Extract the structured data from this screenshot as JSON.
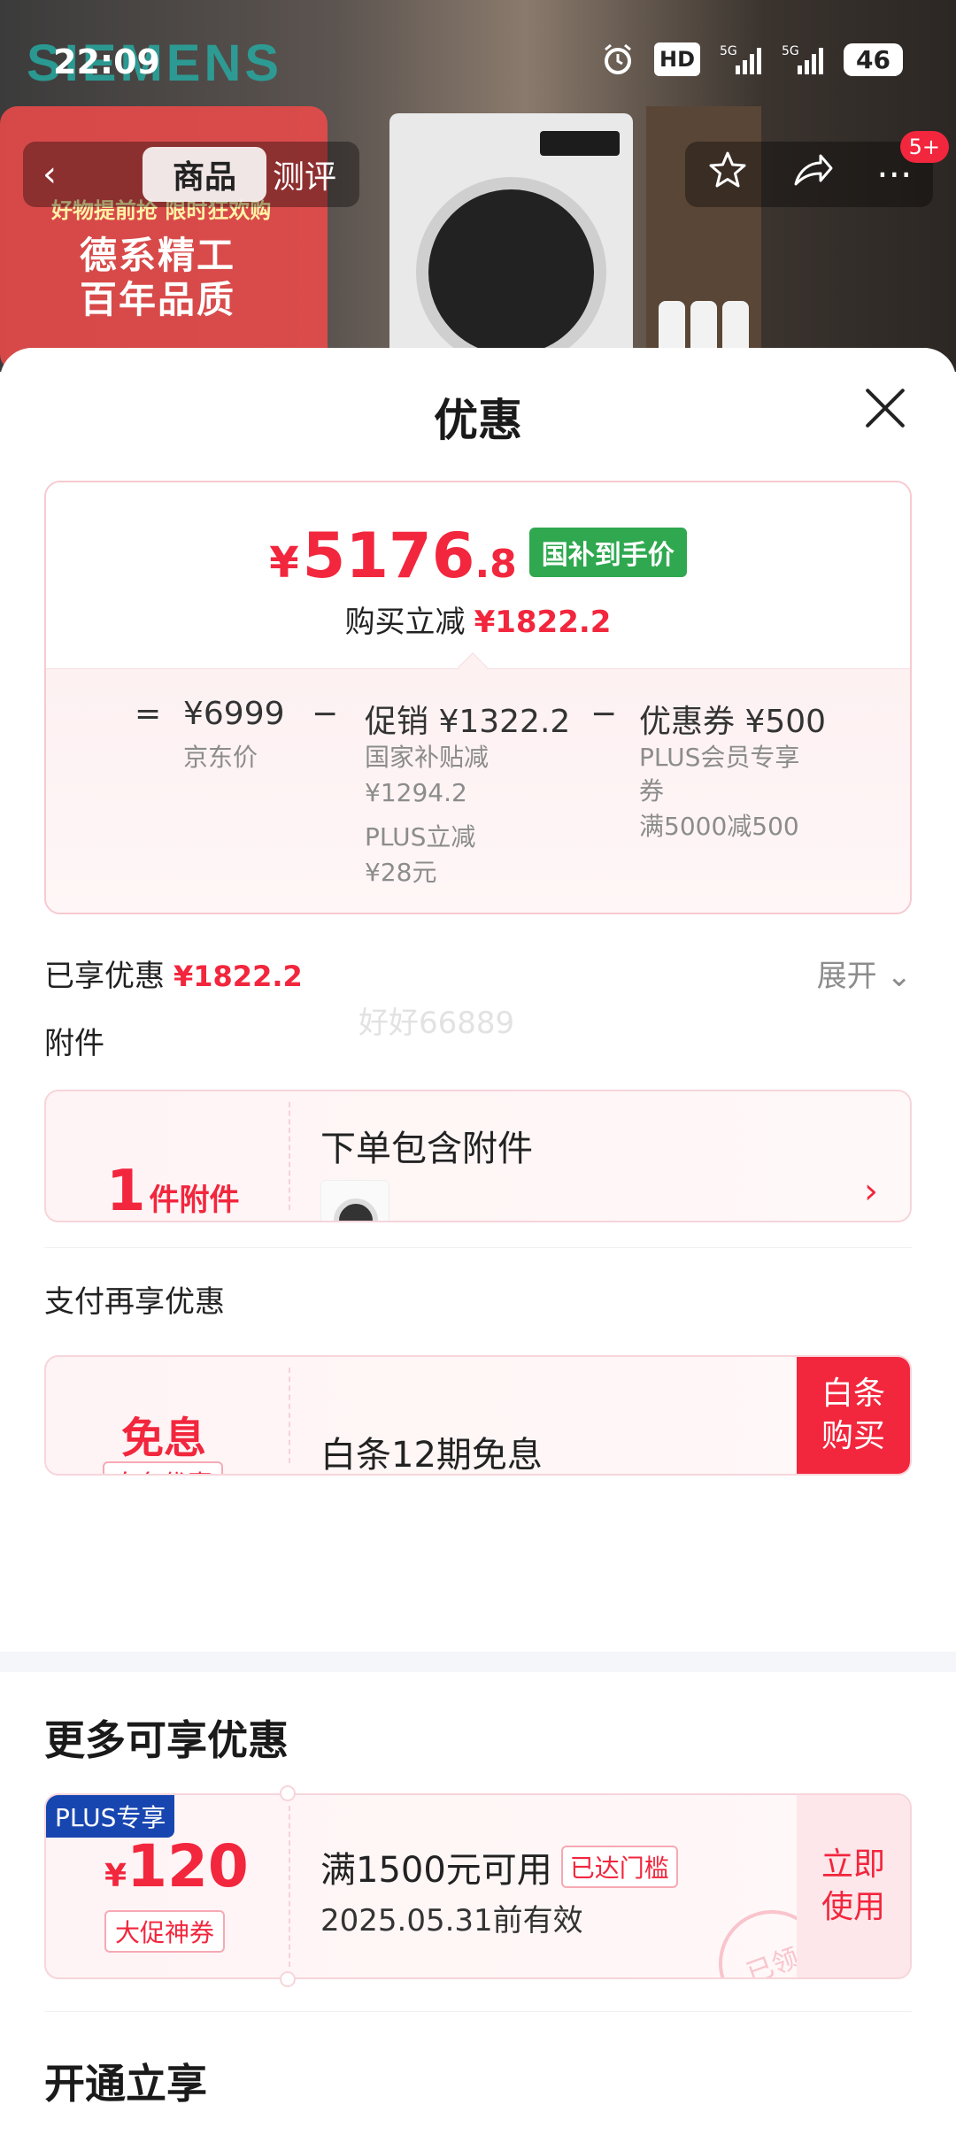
{
  "status_bar": {
    "time": "22:09",
    "icons": [
      "alarm-icon",
      "hd-icon",
      "5g-signal-icon",
      "5g-signal-icon"
    ],
    "hd_label": "HD",
    "battery": "46"
  },
  "background": {
    "brand": "SIEMENS",
    "promo_line1": "德系精工",
    "promo_line2": "百年品质",
    "promo_small": "好物提前抢 限时狂欢购"
  },
  "nav": {
    "tabs": [
      {
        "label": "商品",
        "active": true
      },
      {
        "label": "测评",
        "active": false
      }
    ],
    "badge": "5+",
    "action_icons": [
      "star-icon",
      "share-icon",
      "more-icon"
    ]
  },
  "sheet": {
    "title": "优惠",
    "price": {
      "currency": "¥",
      "integer": "5176",
      "decimal": ".8",
      "tag": "国补到手价",
      "subtitle_label": "购买立减",
      "subtitle_amount": "¥1822.2"
    },
    "breakdown": {
      "eq": "=",
      "minus": "−",
      "jd_price": "¥6999",
      "jd_price_label": "京东价",
      "promo": "促销 ¥1322.2",
      "promo_detail1": "国家补贴减",
      "promo_detail2": "¥1294.2",
      "promo_detail3": "PLUS立减",
      "promo_detail4": "¥28元",
      "coupon": "优惠券 ¥500",
      "coupon_detail1": "PLUS会员专享",
      "coupon_detail2": "券",
      "coupon_detail3": "满5000减500"
    },
    "enjoyed_label": "已享优惠",
    "enjoyed_amount": "¥1822.2",
    "expand_label": "展开",
    "watermark": "好好66889",
    "accessories": {
      "section_label": "附件",
      "count": "1",
      "unit": "件附件",
      "title": "下单包含附件"
    },
    "payment": {
      "section_label": "支付再享优惠",
      "main": "免息",
      "tag": "白条优惠",
      "desc": "白条12期免息",
      "button": "白条购买"
    },
    "more": {
      "section_title": "更多可享优惠",
      "coupon": {
        "badge": "PLUS专享",
        "currency": "¥",
        "amount": "120",
        "tag": "大促神券",
        "condition": "满1500元可用",
        "reached": "已达门槛",
        "valid": "2025.05.31前有效",
        "button": "立即使用",
        "stamp": "已领"
      }
    },
    "open_section_title": "开通立享"
  }
}
